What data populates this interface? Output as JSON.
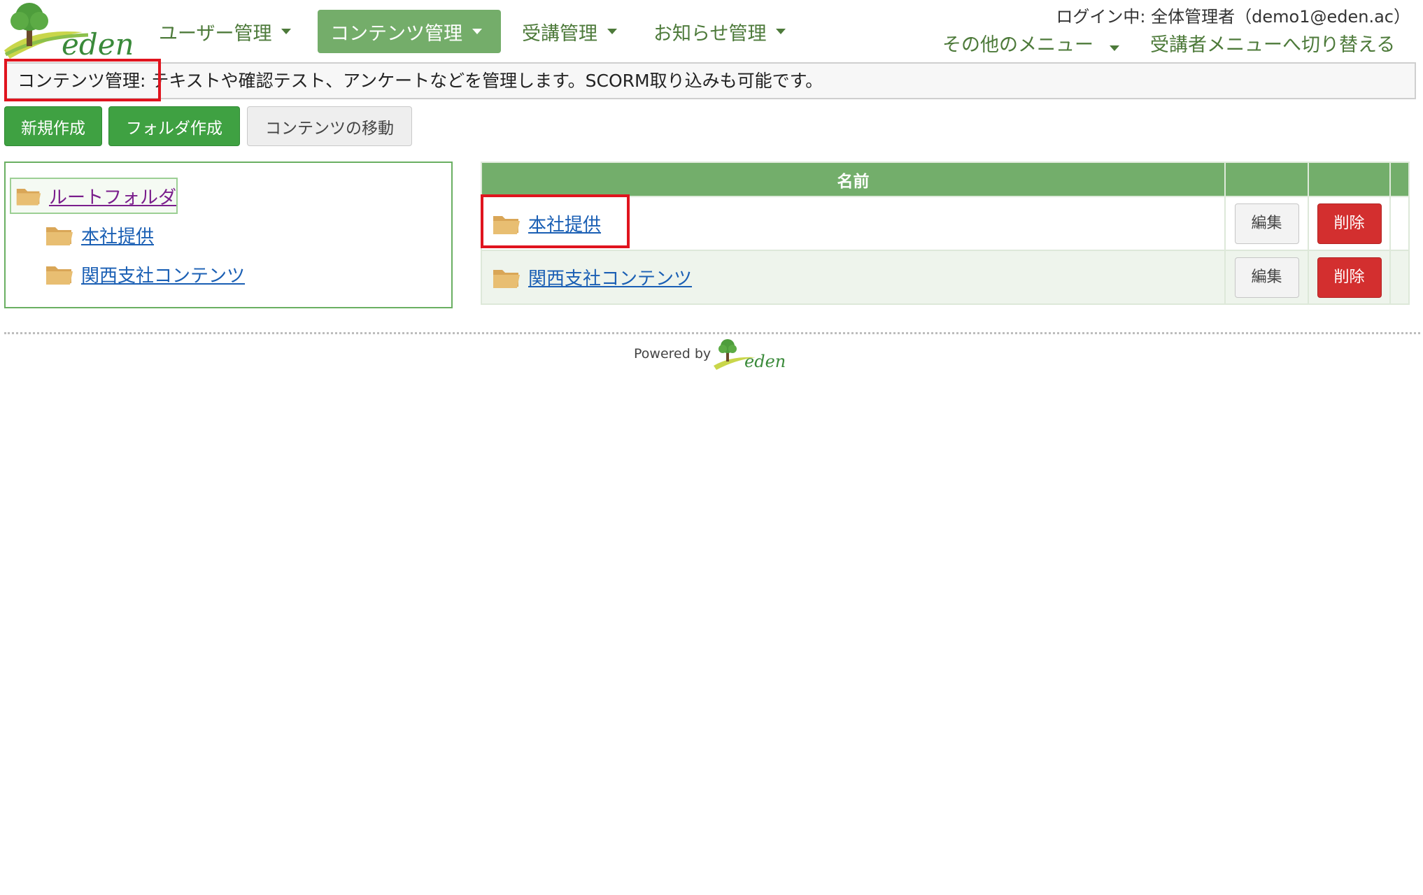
{
  "logo": {
    "text": "eden"
  },
  "nav": {
    "items": [
      {
        "label": "ユーザー管理"
      },
      {
        "label": "コンテンツ管理"
      },
      {
        "label": "受講管理"
      },
      {
        "label": "お知らせ管理"
      }
    ],
    "login_status": "ログイン中: 全体管理者（demo1@eden.ac）",
    "other_menu": "その他のメニュー",
    "switch_menu": "受講者メニューへ切り替える"
  },
  "description": {
    "title": "コンテンツ管理:",
    "text": " テキストや確認テスト、アンケートなどを管理します。SCORM取り込みも可能です。"
  },
  "toolbar": {
    "new_label": "新規作成",
    "folder_label": "フォルダ作成",
    "move_label": "コンテンツの移動"
  },
  "tree": {
    "root": "ルートフォルダ",
    "children": [
      "本社提供",
      "関西支社コンテンツ"
    ]
  },
  "table": {
    "header_name": "名前",
    "rows": [
      {
        "name": "本社提供",
        "edit": "編集",
        "delete": "削除"
      },
      {
        "name": "関西支社コンテンツ",
        "edit": "編集",
        "delete": "削除"
      }
    ]
  },
  "footer": {
    "powered_by": "Powered by",
    "brand": "eden"
  },
  "colors": {
    "accent": "#74ad6a",
    "button_green": "#3fa142",
    "delete_red": "#d32f2f",
    "link": "#1a5fb4",
    "highlight": "#e0141e"
  },
  "icons": [
    "tree-logo-icon",
    "caret-down-icon",
    "folder-icon"
  ]
}
